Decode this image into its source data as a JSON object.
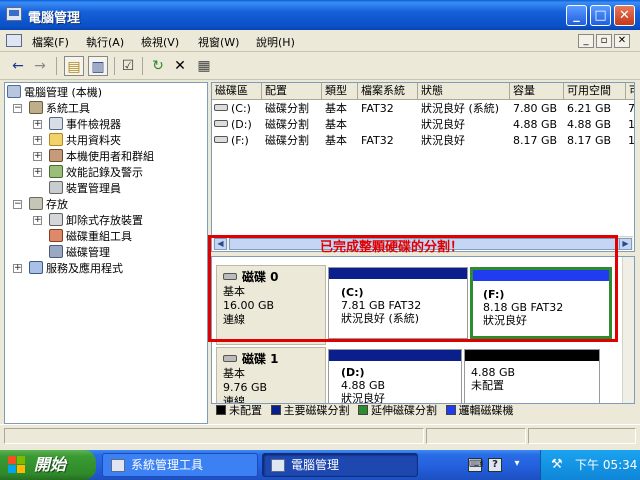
{
  "window": {
    "title": "電腦管理",
    "controls": {
      "minimize": "_",
      "maximize": "□",
      "close": "✕"
    }
  },
  "menu": {
    "items": [
      "檔案(F)",
      "執行(A)",
      "檢視(V)",
      "視窗(W)",
      "說明(H)"
    ],
    "mdi": {
      "minimize": "_",
      "restore": "▫",
      "close": "✕"
    }
  },
  "toolbar": {
    "icons": [
      "back-arrow-icon",
      "forward-arrow-icon",
      "up-folder-icon",
      "show-hide-tree-icon",
      "properties-icon",
      "refresh-icon",
      "delete-icon",
      "help-icon"
    ]
  },
  "tree": {
    "root": "電腦管理 (本機)",
    "system_tools": "系統工具",
    "event_viewer": "事件檢視器",
    "shared_folders": "共用資料夾",
    "local_users": "本機使用者和群組",
    "performance": "效能記錄及警示",
    "device_manager": "裝置管理員",
    "storage": "存放",
    "removable_storage": "卸除式存放裝置",
    "defragmenter": "磁碟重組工具",
    "disk_management": "磁碟管理",
    "services": "服務及應用程式"
  },
  "volume_list": {
    "columns": [
      "磁碟區",
      "配置",
      "類型",
      "檔案系統",
      "狀態",
      "容量",
      "可用空間",
      "可"
    ],
    "rows": [
      {
        "volume": "(C:)",
        "layout": "磁碟分割",
        "type": "基本",
        "fs": "FAT32",
        "status": "狀況良好 (系統)",
        "capacity": "7.80 GB",
        "free": "6.21 GB",
        "extra": "7"
      },
      {
        "volume": "(D:)",
        "layout": "磁碟分割",
        "type": "基本",
        "fs": "",
        "status": "狀況良好",
        "capacity": "4.88 GB",
        "free": "4.88 GB",
        "extra": "1"
      },
      {
        "volume": "(F:)",
        "layout": "磁碟分割",
        "type": "基本",
        "fs": "FAT32",
        "status": "狀況良好",
        "capacity": "8.17 GB",
        "free": "8.17 GB",
        "extra": "1"
      }
    ]
  },
  "annotation": "已完成整顆硬碟的分割！",
  "disks": [
    {
      "name": "磁碟 0",
      "type": "基本",
      "size": "16.00 GB",
      "status": "連線",
      "partitions": [
        {
          "title": "(C:)",
          "detail": "7.81 GB FAT32",
          "status": "狀況良好 (系統)"
        },
        {
          "title": "(F:)",
          "detail": "8.18 GB FAT32",
          "status": "狀況良好"
        }
      ]
    },
    {
      "name": "磁碟 1",
      "type": "基本",
      "size": "9.76 GB",
      "status": "連線",
      "partitions": [
        {
          "title": "(D:)",
          "detail": "4.88 GB",
          "status": "狀況良好"
        },
        {
          "title": "",
          "detail": "4.88 GB",
          "status": "未配置"
        }
      ]
    }
  ],
  "legend": {
    "unallocated": "未配置",
    "primary": "主要磁碟分割",
    "extended": "延伸磁碟分割",
    "logical": "邏輯磁碟機"
  },
  "colors": {
    "unallocated": "#000000",
    "primary": "#0a1f8c",
    "extended": "#2e8b2e",
    "logical": "#1f3cf0",
    "annotation": "#e00000"
  },
  "taskbar": {
    "start": "開始",
    "tasks": [
      "系統管理工具",
      "電腦管理"
    ],
    "clock": "下午 05:34"
  }
}
